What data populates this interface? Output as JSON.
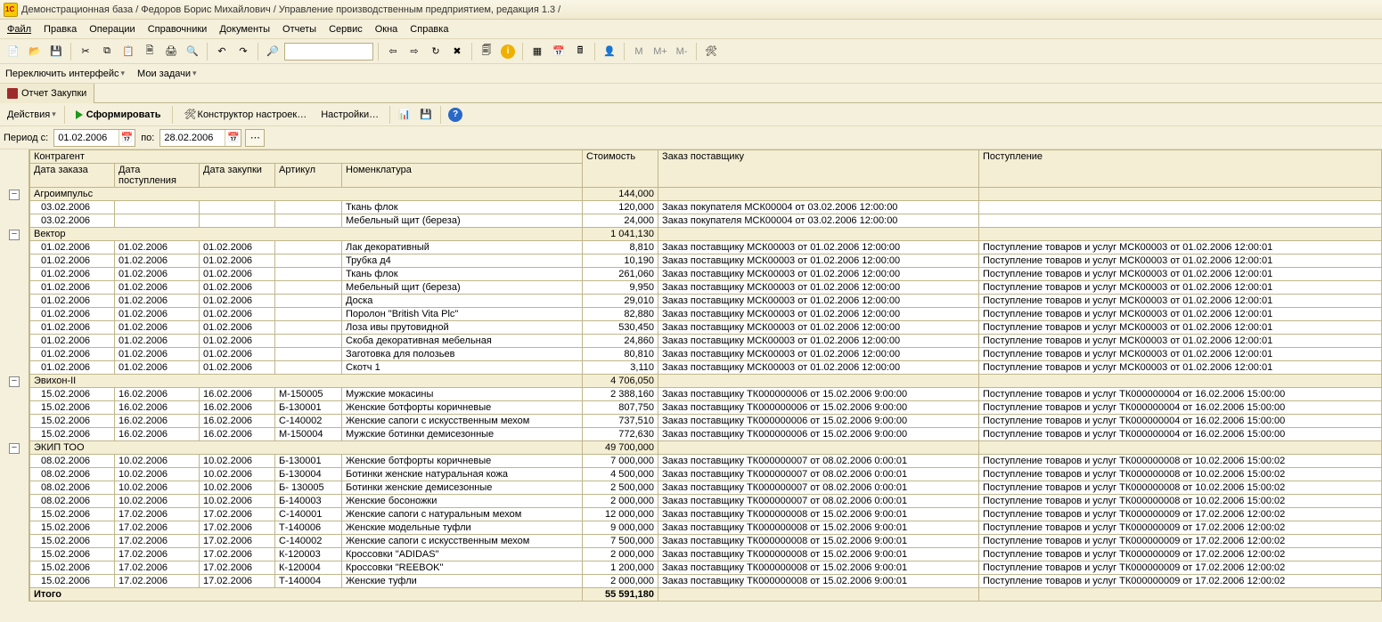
{
  "title": "Демонстрационная база / Федоров Борис Михайлович / Управление производственным предприятием, редакция 1.3 /",
  "menu": {
    "file": "Файл",
    "edit": "Правка",
    "ops": "Операции",
    "refs": "Справочники",
    "docs": "Документы",
    "reports": "Отчеты",
    "service": "Сервис",
    "windows": "Окна",
    "help": "Справка"
  },
  "secondary": {
    "switch_ui": "Переключить интерфейс",
    "my_tasks": "Мои задачи"
  },
  "tab": {
    "label": "Отчет  Закупки"
  },
  "actions": {
    "actions": "Действия",
    "generate": "Сформировать",
    "constructor": "Конструктор настроек…",
    "settings": "Настройки…"
  },
  "period": {
    "label_from": "Период с:",
    "from": "01.02.2006",
    "label_to": "по:",
    "to": "28.02.2006"
  },
  "headers": {
    "contragent": "Контрагент",
    "order_date": "Дата заказа",
    "receipt_date": "Дата поступления",
    "purchase_date": "Дата закупки",
    "article": "Артикул",
    "nomenclature": "Номенклатура",
    "cost": "Стоимость",
    "supplier_order": "Заказ поставщику",
    "receipt": "Поступление"
  },
  "groups": [
    {
      "name": "Агроимпульс",
      "cost": "144,000",
      "rows": [
        {
          "d1": "03.02.2006",
          "d2": "",
          "d3": "",
          "art": "",
          "nom": "Ткань флок",
          "cost": "120,000",
          "order": "Заказ покупателя МСК00004 от 03.02.2006 12:00:00",
          "rec": ""
        },
        {
          "d1": "03.02.2006",
          "d2": "",
          "d3": "",
          "art": "",
          "nom": "Мебельный щит (береза)",
          "cost": "24,000",
          "order": "Заказ покупателя МСК00004 от 03.02.2006 12:00:00",
          "rec": ""
        }
      ]
    },
    {
      "name": "Вектор",
      "cost": "1 041,130",
      "rows": [
        {
          "d1": "01.02.2006",
          "d2": "01.02.2006",
          "d3": "01.02.2006",
          "art": "",
          "nom": "Лак декоративный",
          "cost": "8,810",
          "order": "Заказ поставщику МСК00003 от 01.02.2006 12:00:00",
          "rec": "Поступление товаров и услуг МСК00003 от 01.02.2006 12:00:01"
        },
        {
          "d1": "01.02.2006",
          "d2": "01.02.2006",
          "d3": "01.02.2006",
          "art": "",
          "nom": "Трубка д4",
          "cost": "10,190",
          "order": "Заказ поставщику МСК00003 от 01.02.2006 12:00:00",
          "rec": "Поступление товаров и услуг МСК00003 от 01.02.2006 12:00:01"
        },
        {
          "d1": "01.02.2006",
          "d2": "01.02.2006",
          "d3": "01.02.2006",
          "art": "",
          "nom": "Ткань флок",
          "cost": "261,060",
          "order": "Заказ поставщику МСК00003 от 01.02.2006 12:00:00",
          "rec": "Поступление товаров и услуг МСК00003 от 01.02.2006 12:00:01"
        },
        {
          "d1": "01.02.2006",
          "d2": "01.02.2006",
          "d3": "01.02.2006",
          "art": "",
          "nom": "Мебельный щит (береза)",
          "cost": "9,950",
          "order": "Заказ поставщику МСК00003 от 01.02.2006 12:00:00",
          "rec": "Поступление товаров и услуг МСК00003 от 01.02.2006 12:00:01"
        },
        {
          "d1": "01.02.2006",
          "d2": "01.02.2006",
          "d3": "01.02.2006",
          "art": "",
          "nom": "Доска",
          "cost": "29,010",
          "order": "Заказ поставщику МСК00003 от 01.02.2006 12:00:00",
          "rec": "Поступление товаров и услуг МСК00003 от 01.02.2006 12:00:01"
        },
        {
          "d1": "01.02.2006",
          "d2": "01.02.2006",
          "d3": "01.02.2006",
          "art": "",
          "nom": "Поролон \"British Vita Plc\"",
          "cost": "82,880",
          "order": "Заказ поставщику МСК00003 от 01.02.2006 12:00:00",
          "rec": "Поступление товаров и услуг МСК00003 от 01.02.2006 12:00:01"
        },
        {
          "d1": "01.02.2006",
          "d2": "01.02.2006",
          "d3": "01.02.2006",
          "art": "",
          "nom": "Лоза ивы прутовидной",
          "cost": "530,450",
          "order": "Заказ поставщику МСК00003 от 01.02.2006 12:00:00",
          "rec": "Поступление товаров и услуг МСК00003 от 01.02.2006 12:00:01"
        },
        {
          "d1": "01.02.2006",
          "d2": "01.02.2006",
          "d3": "01.02.2006",
          "art": "",
          "nom": "Скоба декоративная мебельная",
          "cost": "24,860",
          "order": "Заказ поставщику МСК00003 от 01.02.2006 12:00:00",
          "rec": "Поступление товаров и услуг МСК00003 от 01.02.2006 12:00:01"
        },
        {
          "d1": "01.02.2006",
          "d2": "01.02.2006",
          "d3": "01.02.2006",
          "art": "",
          "nom": "Заготовка для полозьев",
          "cost": "80,810",
          "order": "Заказ поставщику МСК00003 от 01.02.2006 12:00:00",
          "rec": "Поступление товаров и услуг МСК00003 от 01.02.2006 12:00:01"
        },
        {
          "d1": "01.02.2006",
          "d2": "01.02.2006",
          "d3": "01.02.2006",
          "art": "",
          "nom": "Скотч 1",
          "cost": "3,110",
          "order": "Заказ поставщику МСК00003 от 01.02.2006 12:00:00",
          "rec": "Поступление товаров и услуг МСК00003 от 01.02.2006 12:00:01"
        }
      ]
    },
    {
      "name": "Эвихон-II",
      "cost": "4 706,050",
      "rows": [
        {
          "d1": "15.02.2006",
          "d2": "16.02.2006",
          "d3": "16.02.2006",
          "art": "М-150005",
          "nom": "Мужские мокасины",
          "cost": "2 388,160",
          "order": "Заказ поставщику ТК000000006 от 15.02.2006 9:00:00",
          "rec": "Поступление товаров и услуг ТК000000004 от 16.02.2006 15:00:00"
        },
        {
          "d1": "15.02.2006",
          "d2": "16.02.2006",
          "d3": "16.02.2006",
          "art": "Б-130001",
          "nom": "Женские ботфорты коричневые",
          "cost": "807,750",
          "order": "Заказ поставщику ТК000000006 от 15.02.2006 9:00:00",
          "rec": "Поступление товаров и услуг ТК000000004 от 16.02.2006 15:00:00"
        },
        {
          "d1": "15.02.2006",
          "d2": "16.02.2006",
          "d3": "16.02.2006",
          "art": "С-140002",
          "nom": "Женские сапоги с искусственным мехом",
          "cost": "737,510",
          "order": "Заказ поставщику ТК000000006 от 15.02.2006 9:00:00",
          "rec": "Поступление товаров и услуг ТК000000004 от 16.02.2006 15:00:00"
        },
        {
          "d1": "15.02.2006",
          "d2": "16.02.2006",
          "d3": "16.02.2006",
          "art": "М-150004",
          "nom": "Мужские ботинки демисезонные",
          "cost": "772,630",
          "order": "Заказ поставщику ТК000000006 от 15.02.2006 9:00:00",
          "rec": "Поступление товаров и услуг ТК000000004 от 16.02.2006 15:00:00"
        }
      ]
    },
    {
      "name": "ЭКИП ТОО",
      "cost": "49 700,000",
      "rows": [
        {
          "d1": "08.02.2006",
          "d2": "10.02.2006",
          "d3": "10.02.2006",
          "art": "Б-130001",
          "nom": "Женские ботфорты коричневые",
          "cost": "7 000,000",
          "order": "Заказ поставщику ТК000000007 от 08.02.2006 0:00:01",
          "rec": "Поступление товаров и услуг ТК000000008 от 10.02.2006 15:00:02"
        },
        {
          "d1": "08.02.2006",
          "d2": "10.02.2006",
          "d3": "10.02.2006",
          "art": "Б-130004",
          "nom": "Ботинки женские натуральная кожа",
          "cost": "4 500,000",
          "order": "Заказ поставщику ТК000000007 от 08.02.2006 0:00:01",
          "rec": "Поступление товаров и услуг ТК000000008 от 10.02.2006 15:00:02"
        },
        {
          "d1": "08.02.2006",
          "d2": "10.02.2006",
          "d3": "10.02.2006",
          "art": "Б- 130005",
          "nom": "Ботинки женские демисезонные",
          "cost": "2 500,000",
          "order": "Заказ поставщику ТК000000007 от 08.02.2006 0:00:01",
          "rec": "Поступление товаров и услуг ТК000000008 от 10.02.2006 15:00:02"
        },
        {
          "d1": "08.02.2006",
          "d2": "10.02.2006",
          "d3": "10.02.2006",
          "art": "Б-140003",
          "nom": "Женские босоножки",
          "cost": "2 000,000",
          "order": "Заказ поставщику ТК000000007 от 08.02.2006 0:00:01",
          "rec": "Поступление товаров и услуг ТК000000008 от 10.02.2006 15:00:02"
        },
        {
          "d1": "15.02.2006",
          "d2": "17.02.2006",
          "d3": "17.02.2006",
          "art": "С-140001",
          "nom": "Женские сапоги с натуральным мехом",
          "cost": "12 000,000",
          "order": "Заказ поставщику ТК000000008 от 15.02.2006 9:00:01",
          "rec": "Поступление товаров и услуг ТК000000009 от 17.02.2006 12:00:02"
        },
        {
          "d1": "15.02.2006",
          "d2": "17.02.2006",
          "d3": "17.02.2006",
          "art": "Т-140006",
          "nom": "Женские модельные туфли",
          "cost": "9 000,000",
          "order": "Заказ поставщику ТК000000008 от 15.02.2006 9:00:01",
          "rec": "Поступление товаров и услуг ТК000000009 от 17.02.2006 12:00:02"
        },
        {
          "d1": "15.02.2006",
          "d2": "17.02.2006",
          "d3": "17.02.2006",
          "art": "С-140002",
          "nom": "Женские сапоги с искусственным мехом",
          "cost": "7 500,000",
          "order": "Заказ поставщику ТК000000008 от 15.02.2006 9:00:01",
          "rec": "Поступление товаров и услуг ТК000000009 от 17.02.2006 12:00:02"
        },
        {
          "d1": "15.02.2006",
          "d2": "17.02.2006",
          "d3": "17.02.2006",
          "art": "К-120003",
          "nom": "Кроссовки \"ADIDAS\"",
          "cost": "2 000,000",
          "order": "Заказ поставщику ТК000000008 от 15.02.2006 9:00:01",
          "rec": "Поступление товаров и услуг ТК000000009 от 17.02.2006 12:00:02"
        },
        {
          "d1": "15.02.2006",
          "d2": "17.02.2006",
          "d3": "17.02.2006",
          "art": "К-120004",
          "nom": "Кроссовки \"REEBOK\"",
          "cost": "1 200,000",
          "order": "Заказ поставщику ТК000000008 от 15.02.2006 9:00:01",
          "rec": "Поступление товаров и услуг ТК000000009 от 17.02.2006 12:00:02"
        },
        {
          "d1": "15.02.2006",
          "d2": "17.02.2006",
          "d3": "17.02.2006",
          "art": "Т-140004",
          "nom": "Женские туфли",
          "cost": "2 000,000",
          "order": "Заказ поставщику ТК000000008 от 15.02.2006 9:00:01",
          "rec": "Поступление товаров и услуг ТК000000009 от 17.02.2006 12:00:02"
        }
      ]
    }
  ],
  "total": {
    "label": "Итого",
    "cost": "55 591,180"
  }
}
